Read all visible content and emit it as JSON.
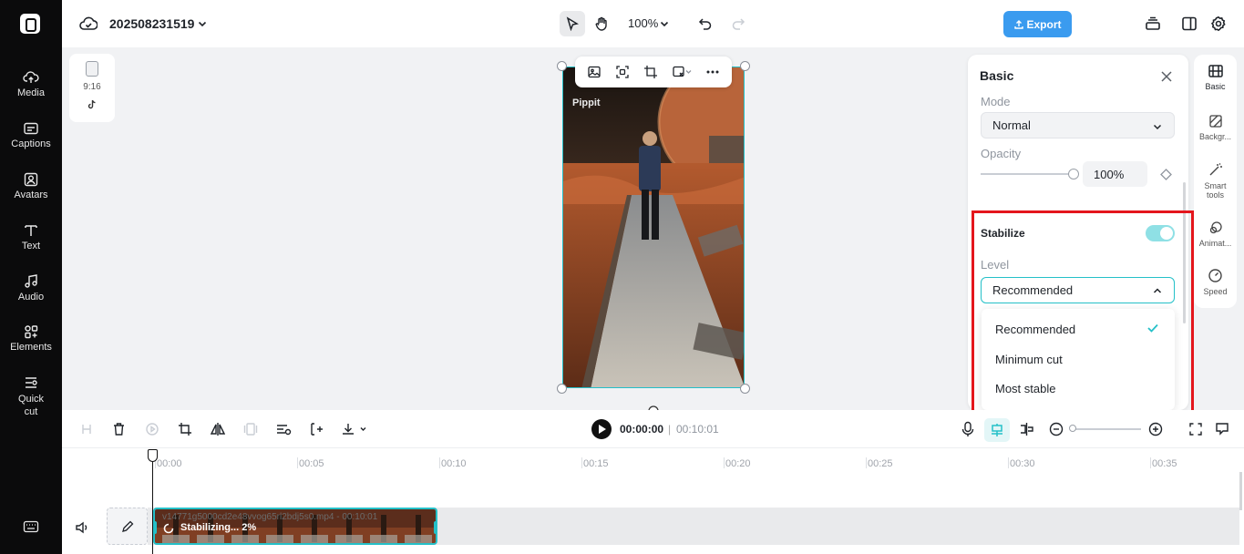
{
  "app": {
    "project_name": "202508231519",
    "zoom": "100%",
    "export_label": "Export",
    "accent": "#24c0c8",
    "export_color": "#3a9bef"
  },
  "left_nav": [
    {
      "label": "Media",
      "icon": "cloud-upload-icon"
    },
    {
      "label": "Captions",
      "icon": "captions-icon"
    },
    {
      "label": "Avatars",
      "icon": "avatar-icon"
    },
    {
      "label": "Text",
      "icon": "text-icon"
    },
    {
      "label": "Audio",
      "icon": "music-note-icon"
    },
    {
      "label": "Elements",
      "icon": "elements-icon"
    },
    {
      "label": "Quick cut",
      "icon": "quick-cut-icon"
    }
  ],
  "canvas": {
    "aspect_ratio": "9:16",
    "platform_icon": "tiktok-icon",
    "watermark": "Pippit"
  },
  "panel": {
    "title": "Basic",
    "mode_label": "Mode",
    "mode_value": "Normal",
    "opacity_label": "Opacity",
    "opacity_value": "100%",
    "opacity_level": 1.0,
    "stabilize_label": "Stabilize",
    "stabilize_on": true,
    "level_label": "Level",
    "level_value": "Recommended",
    "level_options": [
      "Recommended",
      "Minimum cut",
      "Most stable"
    ],
    "selected_option": "Recommended"
  },
  "right_tabs": [
    "Basic",
    "Backgr...",
    "Smart tools",
    "Animat...",
    "Speed"
  ],
  "player": {
    "current_time": "00:00:00",
    "separator": "|",
    "total_time": "00:10:01"
  },
  "timeline": {
    "ticks": [
      "00:00",
      "00:05",
      "00:10",
      "00:15",
      "00:20",
      "00:25",
      "00:30",
      "00:35"
    ],
    "clip_name": "v14771g5000cd2e48vvog65rl2bdj5s0.mp4 - 00:10:01",
    "clip_status": "Stabilizing... 2%",
    "clip_progress": 0.02
  }
}
